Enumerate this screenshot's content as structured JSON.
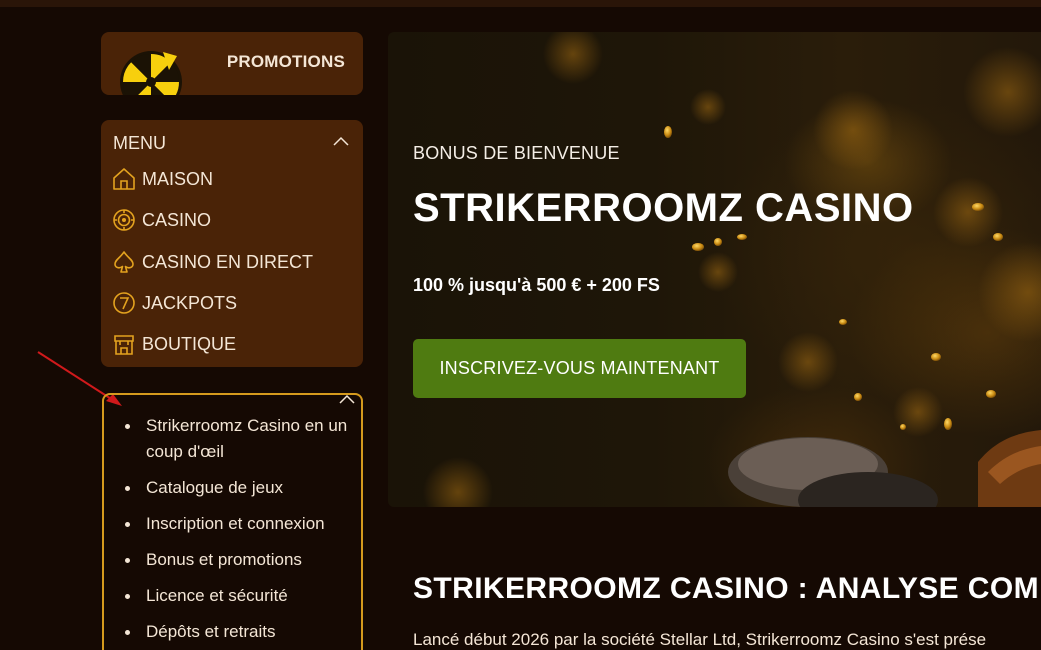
{
  "sidebar": {
    "promo_label": "PROMOTIONS",
    "menu": {
      "heading": "MENU",
      "items": [
        {
          "label": "MAISON",
          "icon": "house-icon"
        },
        {
          "label": "CASINO",
          "icon": "chip-icon"
        },
        {
          "label": "CASINO EN DIRECT",
          "icon": "spade-icon"
        },
        {
          "label": "JACKPOTS",
          "icon": "seven-icon"
        },
        {
          "label": "BOUTIQUE",
          "icon": "shop-icon"
        }
      ]
    },
    "toc": {
      "items": [
        "Strikerroomz Casino en un coup d'œil",
        "Catalogue de jeux",
        "Inscription et connexion",
        "Bonus et promotions",
        "Licence et sécurité",
        "Dépôts et retraits"
      ]
    }
  },
  "hero": {
    "eyebrow": "BONUS DE BIENVENUE",
    "title": "STRIKERROOMZ CASINO",
    "offer": "100 % jusqu'à 500 € + 200 FS",
    "cta": "INSCRIVEZ-VOUS MAINTENANT"
  },
  "article": {
    "title": "STRIKERROOMZ CASINO : ANALYSE COMP",
    "intro": "Lancé début 2026 par la société Stellar Ltd, Strikerroomz Casino s'est prése"
  },
  "colors": {
    "background": "#150903",
    "panel": "#4a2307",
    "accent_gold": "#d59a1d",
    "cta_green": "#4f7b11",
    "annotation_arrow": "#d0191b"
  }
}
